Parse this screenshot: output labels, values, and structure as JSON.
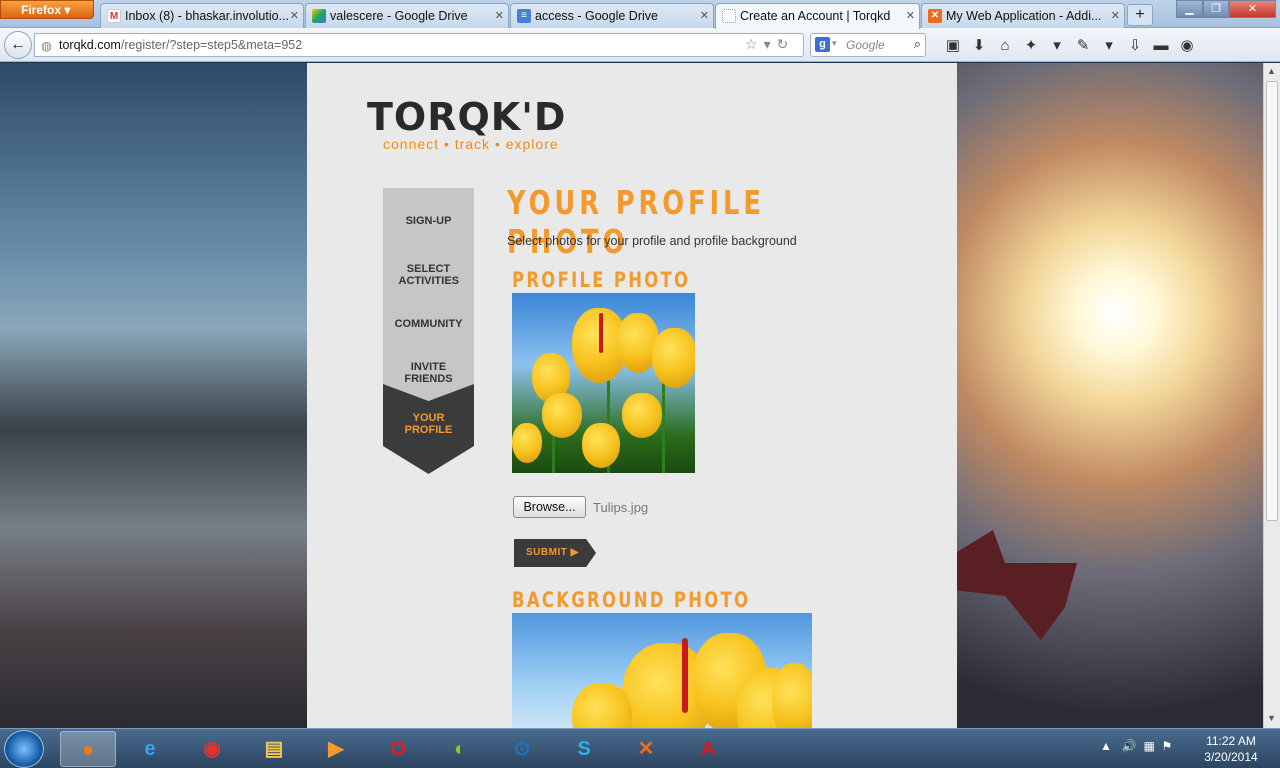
{
  "browser": {
    "menu_button": "Firefox",
    "tabs": [
      {
        "title": "Inbox (8) - bhaskar.involutio...",
        "icon": "gmail-icon",
        "active": false
      },
      {
        "title": "valescere - Google Drive",
        "icon": "google-drive-icon",
        "active": false
      },
      {
        "title": "access - Google Drive",
        "icon": "google-docs-icon",
        "active": false
      },
      {
        "title": "Create an Account | Torqkd",
        "icon": "blank-page-icon",
        "active": true
      },
      {
        "title": "My Web Application - Addi...",
        "icon": "xampp-icon",
        "active": false
      }
    ],
    "new_tab": "+",
    "url_host": "torqkd.com",
    "url_path": "/register/?step=step5&meta=952",
    "search_placeholder": "Google",
    "search_engine_letter": "g"
  },
  "page": {
    "logo": "TORQK'D",
    "tagline": "connect • track • explore",
    "steps": [
      {
        "label": "SIGN-UP",
        "active": false
      },
      {
        "label": "SELECT ACTIVITIES",
        "active": false
      },
      {
        "label": "COMMUNITY",
        "active": false
      },
      {
        "label": "INVITE FRIENDS",
        "active": false
      },
      {
        "label": "YOUR PROFILE",
        "active": true
      }
    ],
    "title": "YOUR PROFILE PHOTO",
    "subtitle": "Select photos for your profile and profile background",
    "profile_heading": "PROFILE PHOTO",
    "browse_label": "Browse...",
    "file_name": "Tulips.jpg",
    "submit_label": "SUBMIT ▶",
    "background_heading": "BACKGROUND PHOTO"
  },
  "taskbar": {
    "apps": [
      "firefox-icon",
      "internet-explorer-icon",
      "chrome-icon",
      "file-explorer-icon",
      "media-player-icon",
      "opera-icon",
      "green-app-icon",
      "teamviewer-icon",
      "skype-icon",
      "xampp-icon",
      "adobe-reader-icon"
    ],
    "time": "11:22 AM",
    "date": "3/20/2014"
  },
  "colors": {
    "accent": "#f39a2c",
    "dark": "#3b3b3b",
    "step": "#c6c6c6"
  }
}
